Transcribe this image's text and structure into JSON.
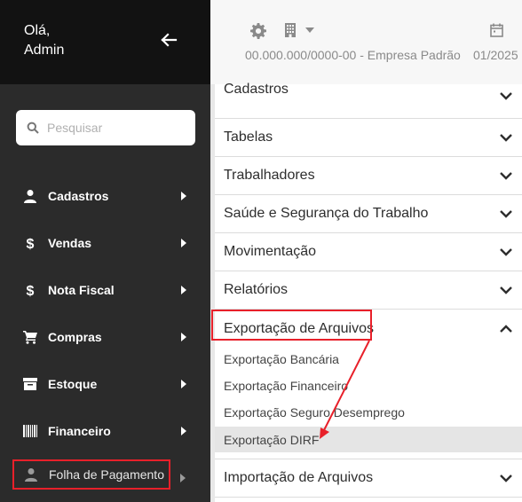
{
  "sidebar": {
    "greeting_line1": "Olá,",
    "greeting_line2": "Admin",
    "back_icon": "arrow-left-icon",
    "search": {
      "placeholder": "Pesquisar",
      "icon": "search-icon"
    },
    "items": [
      {
        "label": "Cadastros",
        "icon": "user-icon"
      },
      {
        "label": "Vendas",
        "icon": "dollar-icon"
      },
      {
        "label": "Nota Fiscal",
        "icon": "dollar-icon"
      },
      {
        "label": "Compras",
        "icon": "cart-icon"
      },
      {
        "label": "Estoque",
        "icon": "archive-icon"
      },
      {
        "label": "Financeiro",
        "icon": "barcode-icon"
      },
      {
        "label": "Folha de Pagamento",
        "icon": "user-icon",
        "active": true
      }
    ]
  },
  "header": {
    "company": "00.000.000/0000-00 - Empresa Padrão",
    "period": "01/2025",
    "icons": [
      "gear-icon",
      "building-icon",
      "caret-down-icon",
      "calendar-icon"
    ]
  },
  "menu": {
    "sections": [
      {
        "label": "Cadastros",
        "expanded": false
      },
      {
        "label": "Tabelas",
        "expanded": false
      },
      {
        "label": "Trabalhadores",
        "expanded": false
      },
      {
        "label": "Saúde e Segurança do Trabalho",
        "expanded": false
      },
      {
        "label": "Movimentação",
        "expanded": false
      },
      {
        "label": "Relatórios",
        "expanded": false
      },
      {
        "label": "Exportação de Arquivos",
        "expanded": true
      },
      {
        "label": "Importação de Arquivos",
        "expanded": false
      }
    ],
    "subitems": [
      {
        "label": "Exportação Bancária"
      },
      {
        "label": "Exportação Financeiro"
      },
      {
        "label": "Exportação Seguro Desemprego"
      },
      {
        "label": "Exportação DIRF",
        "highlighted": true
      }
    ]
  },
  "colors": {
    "sidebar_bg": "#2b2b2b",
    "sidebar_top_bg": "#121212",
    "highlight_red": "#e8202a",
    "header_bg": "#f7f7f7",
    "submenu_highlight": "#e5e5e5"
  }
}
